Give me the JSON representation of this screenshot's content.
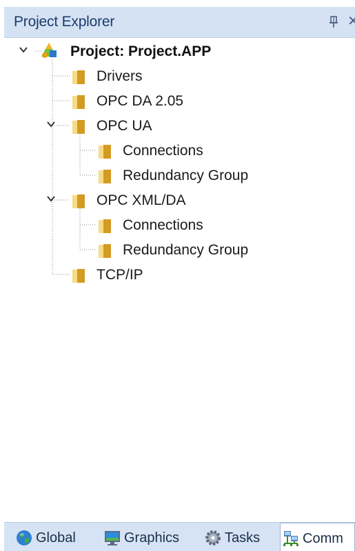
{
  "panel": {
    "title": "Project Explorer",
    "pin_icon": "pin-icon",
    "close_glyph": "✕",
    "accent": "#d5e2f4"
  },
  "tree": {
    "root": {
      "label": "Project: Project.APP",
      "icon": "project-icon",
      "expanded": true
    },
    "nodes": [
      {
        "label": "Drivers",
        "icon": "folder-icon"
      },
      {
        "label": "OPC DA 2.05",
        "icon": "folder-icon"
      },
      {
        "label": "OPC UA",
        "icon": "folder-icon",
        "expanded": true,
        "children": [
          {
            "label": "Connections",
            "icon": "folder-icon"
          },
          {
            "label": "Redundancy Group",
            "icon": "folder-icon"
          }
        ]
      },
      {
        "label": "OPC XML/DA",
        "icon": "folder-icon",
        "expanded": true,
        "children": [
          {
            "label": "Connections",
            "icon": "folder-icon"
          },
          {
            "label": "Redundancy Group",
            "icon": "folder-icon"
          }
        ]
      },
      {
        "label": "TCP/IP",
        "icon": "folder-icon"
      }
    ]
  },
  "bottom_tabs": [
    {
      "label": "Global",
      "icon": "globe-icon",
      "active": false
    },
    {
      "label": "Graphics",
      "icon": "monitor-icon",
      "active": false
    },
    {
      "label": "Tasks",
      "icon": "gear-icon",
      "active": false
    },
    {
      "label": "Comm",
      "icon": "network-icon",
      "active": true
    }
  ]
}
